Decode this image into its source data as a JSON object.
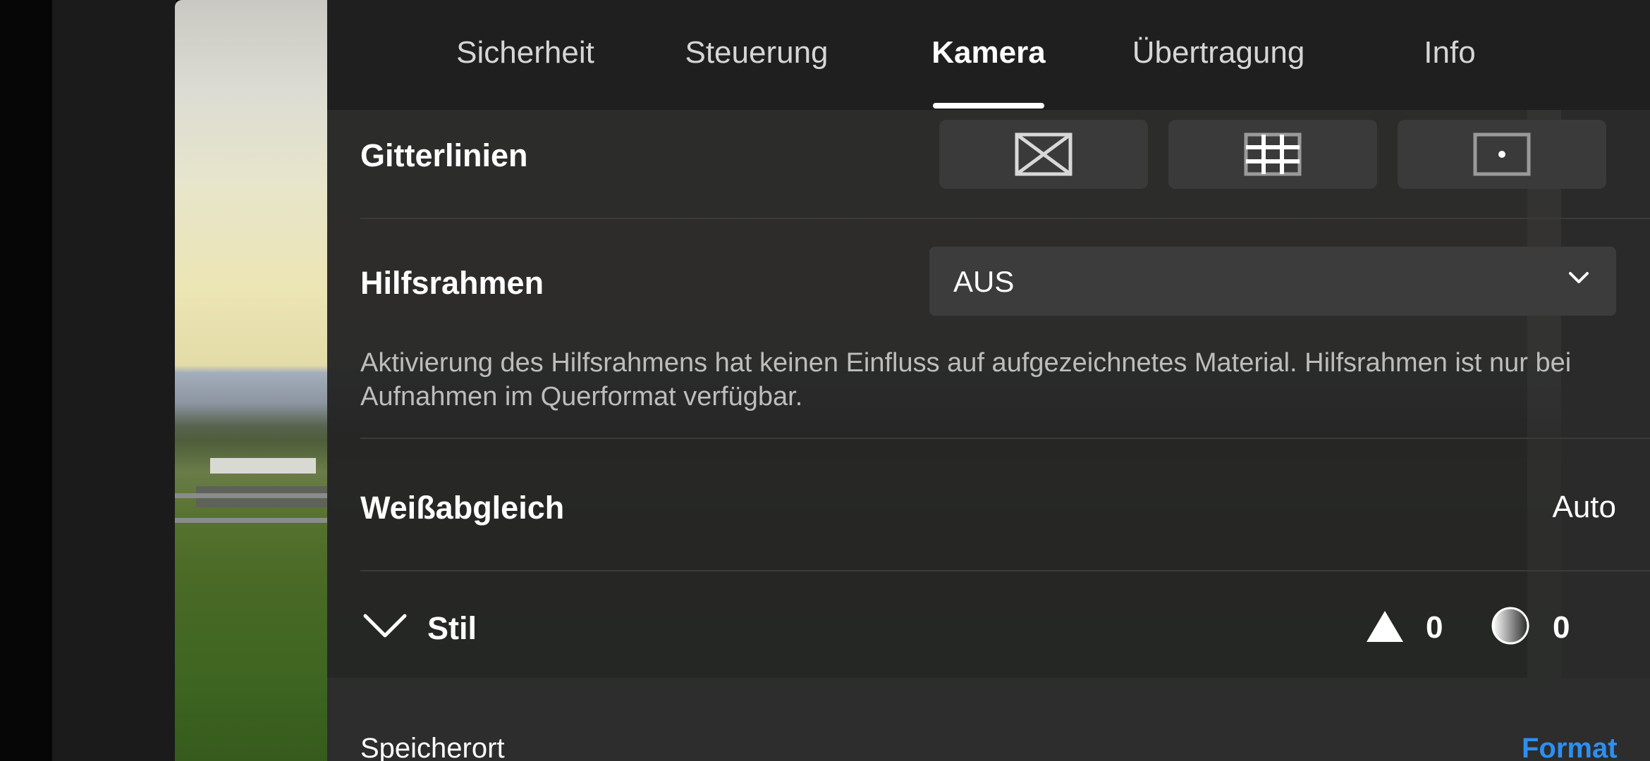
{
  "tabs": [
    {
      "label": "Sicherheit"
    },
    {
      "label": "Steuerung"
    },
    {
      "label": "Kamera"
    },
    {
      "label": "Übertragung"
    },
    {
      "label": "Info"
    }
  ],
  "active_tab": "Kamera",
  "gridlines": {
    "label": "Gitterlinien",
    "options": [
      {
        "icon": "diagonal-grid-icon"
      },
      {
        "icon": "thirds-grid-icon"
      },
      {
        "icon": "center-point-icon"
      }
    ]
  },
  "guide_frame": {
    "label": "Hilfsrahmen",
    "value": "AUS",
    "description": "Aktivierung des Hilfsrahmens hat keinen Einfluss auf aufgezeichnetes Material. Hilfsrahmen ist nur bei Aufnahmen im Querformat verfügbar."
  },
  "white_balance": {
    "label": "Weißabgleich",
    "value": "Auto"
  },
  "style": {
    "label": "Stil",
    "sharpness_value": "0",
    "contrast_value": "0"
  },
  "storage": {
    "label": "Speicherort",
    "format_link": "Format"
  },
  "colors": {
    "panel_bg": "#242424",
    "tab_bar_bg": "#1f1f1f",
    "link_blue": "#2d8ff0"
  }
}
